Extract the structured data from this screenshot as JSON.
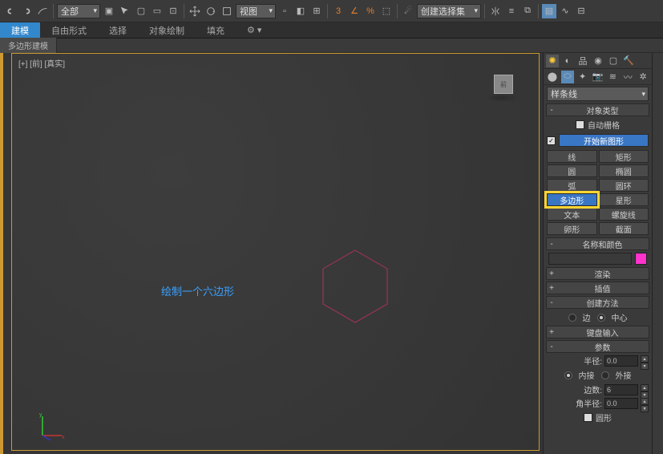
{
  "toolbar": {
    "drop1": "全部",
    "drop2": "视图",
    "drop3": "创建选择集"
  },
  "tabs": {
    "t1": "建模",
    "t2": "自由形式",
    "t3": "选择",
    "t4": "对象绘制",
    "t5": "填充"
  },
  "subtab": "多边形建模",
  "viewport": {
    "label": "[+] [前] [真实]",
    "tip": "绘制一个六边形",
    "cube": "前"
  },
  "cmd": {
    "cat_drop": "样条线",
    "object_type": "对象类型",
    "autogrid": "自动栅格",
    "start_new": "开始新图形",
    "btns": {
      "line": "线",
      "rect": "矩形",
      "circle": "圆",
      "ellipse": "椭圆",
      "arc": "弧",
      "donut": "圆环",
      "ngon": "多边形",
      "star": "星形",
      "text": "文本",
      "helix": "螺旋线",
      "egg": "卵形",
      "section": "截面"
    },
    "name_color": "名称和颜色",
    "render": "渲染",
    "interp": "插值",
    "create_method": "创建方法",
    "edge": "边",
    "center": "中心",
    "kb_entry": "键盘输入",
    "params": "参数",
    "radius": "半径:",
    "radius_v": "0.0",
    "inscribed": "内接",
    "circum": "外接",
    "sides": "边数:",
    "sides_v": "6",
    "corner_r": "角半径:",
    "corner_r_v": "0.0",
    "circular": "圆形"
  }
}
